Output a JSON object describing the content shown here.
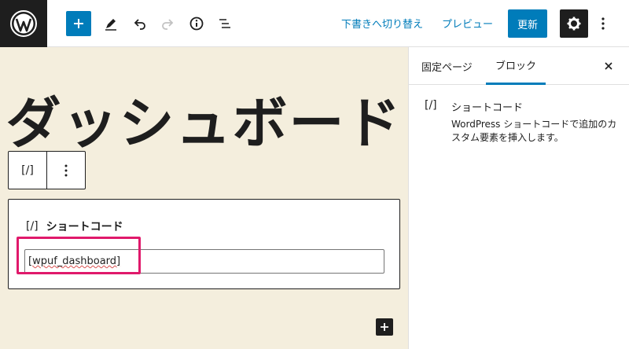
{
  "toolbar": {
    "switch_to_draft": "下書きへ切り替え",
    "preview": "プレビュー",
    "update": "更新"
  },
  "editor": {
    "page_title": "ダッシュボード",
    "block_type_icon": "[/]",
    "block_label": "ショートコード",
    "shortcode_value": "[wpuf_dashboard]"
  },
  "sidebar": {
    "tabs": [
      {
        "label": "固定ページ"
      },
      {
        "label": "ブロック"
      }
    ],
    "block_card": {
      "icon": "[/]",
      "title": "ショートコード",
      "description": "WordPress ショートコードで追加のカスタム要素を挿入します。"
    }
  },
  "colors": {
    "accent": "#007cba",
    "highlight": "#e0196b",
    "canvas": "#f4eedd"
  },
  "icons": [
    "wordpress-logo-icon",
    "plus-icon",
    "pencil-icon",
    "undo-icon",
    "redo-icon",
    "info-icon",
    "list-view-icon",
    "gear-icon",
    "more-vertical-icon",
    "close-icon"
  ]
}
